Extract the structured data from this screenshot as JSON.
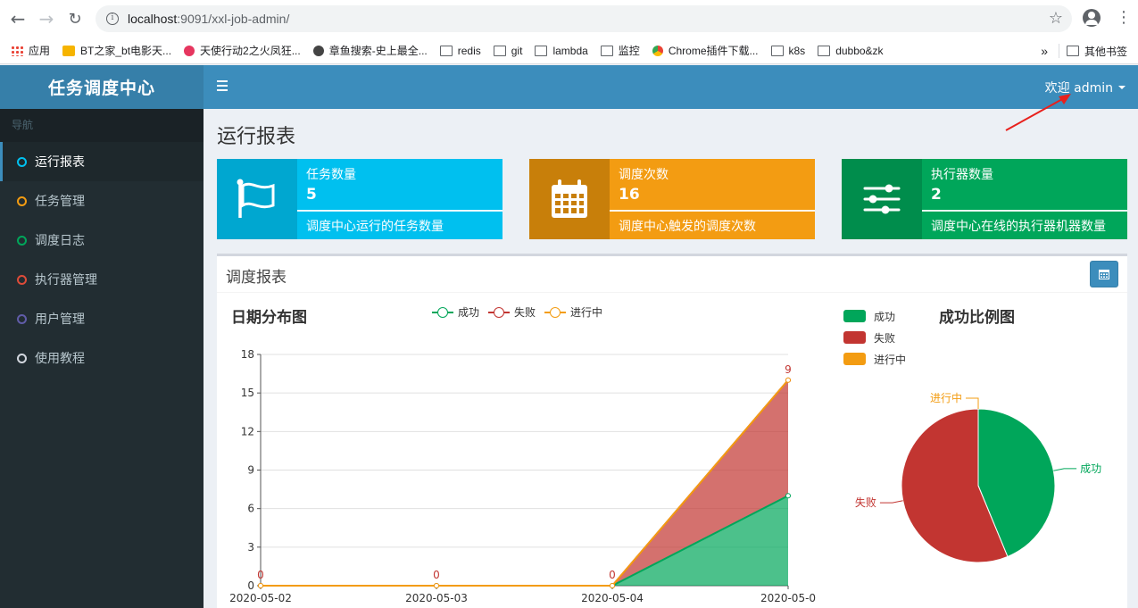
{
  "browser": {
    "url_host": "localhost",
    "url_path": ":9091/xxl-job-admin/",
    "bookmarks": [
      {
        "label": "应用",
        "icon": "apps-grid-icon"
      },
      {
        "label": "BT之家_bt电影天...",
        "icon": "bt-site-icon"
      },
      {
        "label": "天使行动2之火凤狂...",
        "icon": "bookmark-favicon-icon"
      },
      {
        "label": "章鱼搜索-史上最全...",
        "icon": "bookmark-favicon-icon"
      },
      {
        "label": "redis",
        "icon": "folder-icon"
      },
      {
        "label": "git",
        "icon": "folder-icon"
      },
      {
        "label": "lambda",
        "icon": "folder-icon"
      },
      {
        "label": "监控",
        "icon": "folder-icon"
      },
      {
        "label": "Chrome插件下载...",
        "icon": "chrome-icon"
      },
      {
        "label": "k8s",
        "icon": "folder-icon"
      },
      {
        "label": "dubbo&zk",
        "icon": "folder-icon"
      }
    ],
    "overflow": "»",
    "other_bookmarks": "其他书签"
  },
  "header": {
    "logo": "任务调度中心",
    "welcome": "欢迎 admin"
  },
  "sidebar": {
    "section_label": "导航",
    "items": [
      {
        "label": "运行报表",
        "color": "#00c0ef",
        "active": true
      },
      {
        "label": "任务管理",
        "color": "#f39c12"
      },
      {
        "label": "调度日志",
        "color": "#00a65a"
      },
      {
        "label": "执行器管理",
        "color": "#dd4b39"
      },
      {
        "label": "用户管理",
        "color": "#605ca8"
      },
      {
        "label": "使用教程",
        "color": "#d2d6de"
      }
    ]
  },
  "page": {
    "title": "运行报表",
    "info_boxes": [
      {
        "label": "任务数量",
        "value": "5",
        "desc": "调度中心运行的任务数量",
        "icon": "flag-icon",
        "color": "#00c0ef",
        "icon_bg": "#00a7d0"
      },
      {
        "label": "调度次数",
        "value": "16",
        "desc": "调度中心触发的调度次数",
        "icon": "calendar-icon",
        "color": "#f39c12",
        "icon_bg": "#c87f0a"
      },
      {
        "label": "执行器数量",
        "value": "2",
        "desc": "调度中心在线的执行器机器数量",
        "icon": "sliders-icon",
        "color": "#00a65a",
        "icon_bg": "#008d4c"
      }
    ],
    "report_panel_title": "调度报表"
  },
  "chart_data": [
    {
      "type": "area",
      "title": "日期分布图",
      "stacked": true,
      "x": [
        "2020-05-02",
        "2020-05-03",
        "2020-05-04",
        "2020-05-0"
      ],
      "series": [
        {
          "name": "成功",
          "values": [
            0,
            0,
            0,
            7
          ],
          "color": "#00a65a"
        },
        {
          "name": "失败",
          "values": [
            0,
            0,
            0,
            9
          ],
          "color": "#c23531"
        },
        {
          "name": "进行中",
          "values": [
            0,
            0,
            0,
            0
          ],
          "color": "#f39c12"
        }
      ],
      "data_labels": [
        "0",
        "0",
        "0",
        "9"
      ],
      "yticks": [
        0,
        3,
        6,
        9,
        12,
        15,
        18
      ],
      "ylim": [
        0,
        18
      ],
      "grid": true,
      "legend": "top-center"
    },
    {
      "type": "pie",
      "title": "成功比例图",
      "slices": [
        {
          "name": "成功",
          "value": 7,
          "color": "#00a65a"
        },
        {
          "name": "失败",
          "value": 9,
          "color": "#c23531"
        },
        {
          "name": "进行中",
          "value": 0,
          "color": "#f39c12"
        }
      ],
      "legend": "top-left"
    }
  ]
}
